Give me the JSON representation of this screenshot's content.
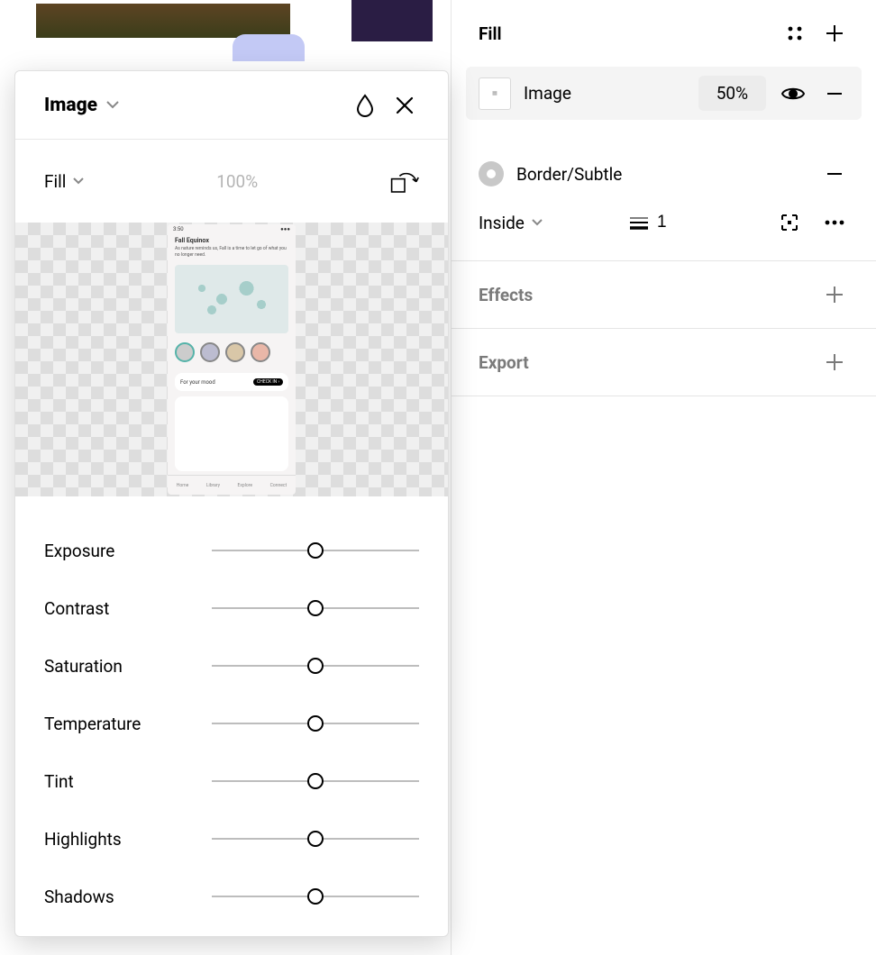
{
  "inspector": {
    "fill_section_title": "Fill",
    "fill_row": {
      "label": "Image",
      "opacity": "50%"
    },
    "border_label": "Border/Subtle",
    "stroke_position": "Inside",
    "stroke_weight": "1",
    "effects_title": "Effects",
    "export_title": "Export"
  },
  "popover": {
    "title": "Image",
    "scale_mode": "Fill",
    "opacity": "100%",
    "sliders": [
      {
        "label": "Exposure"
      },
      {
        "label": "Contrast"
      },
      {
        "label": "Saturation"
      },
      {
        "label": "Temperature"
      },
      {
        "label": "Tint"
      },
      {
        "label": "Highlights"
      },
      {
        "label": "Shadows"
      }
    ],
    "phone": {
      "heading": "Fall Equinox",
      "sub": "As nature reminds us, Fall is a time to let go of what you no longer need.",
      "mood": "For your mood",
      "chip": "CHECK IN ›",
      "nav": [
        "Home",
        "Library",
        "Explore",
        "Connect"
      ]
    }
  }
}
